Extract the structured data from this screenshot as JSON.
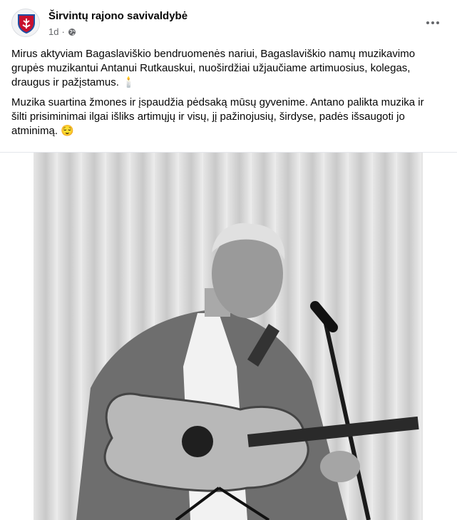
{
  "post": {
    "page_name": "Širvintų rajono savivaldybė",
    "timestamp": "1d",
    "separator": "·",
    "audience_icon": "globe-icon",
    "paragraphs": [
      "Mirus aktyviam Bagaslaviškio bendruomenės nariui, Bagaslaviškio namų muzikavimo grupės muzikantui Antanui Rutkauskui, nuoširdžiai užjaučiame artimuosius, kolegas, draugus ir pažįstamus. 🕯️",
      "Muzika suartina žmones ir įspaudžia pėdsaką mūsų gyvenime. Antano palikta muzika ir šilti prisiminimai ilgai išliks artimųjų ir visų, jį pažinojusių, širdyse, padės išsaugoti jo atminimą. 😌"
    ]
  },
  "colors": {
    "text": "#050505",
    "secondary": "#65676b",
    "crest_red": "#c8102e",
    "crest_blue": "#1f4fa3"
  }
}
